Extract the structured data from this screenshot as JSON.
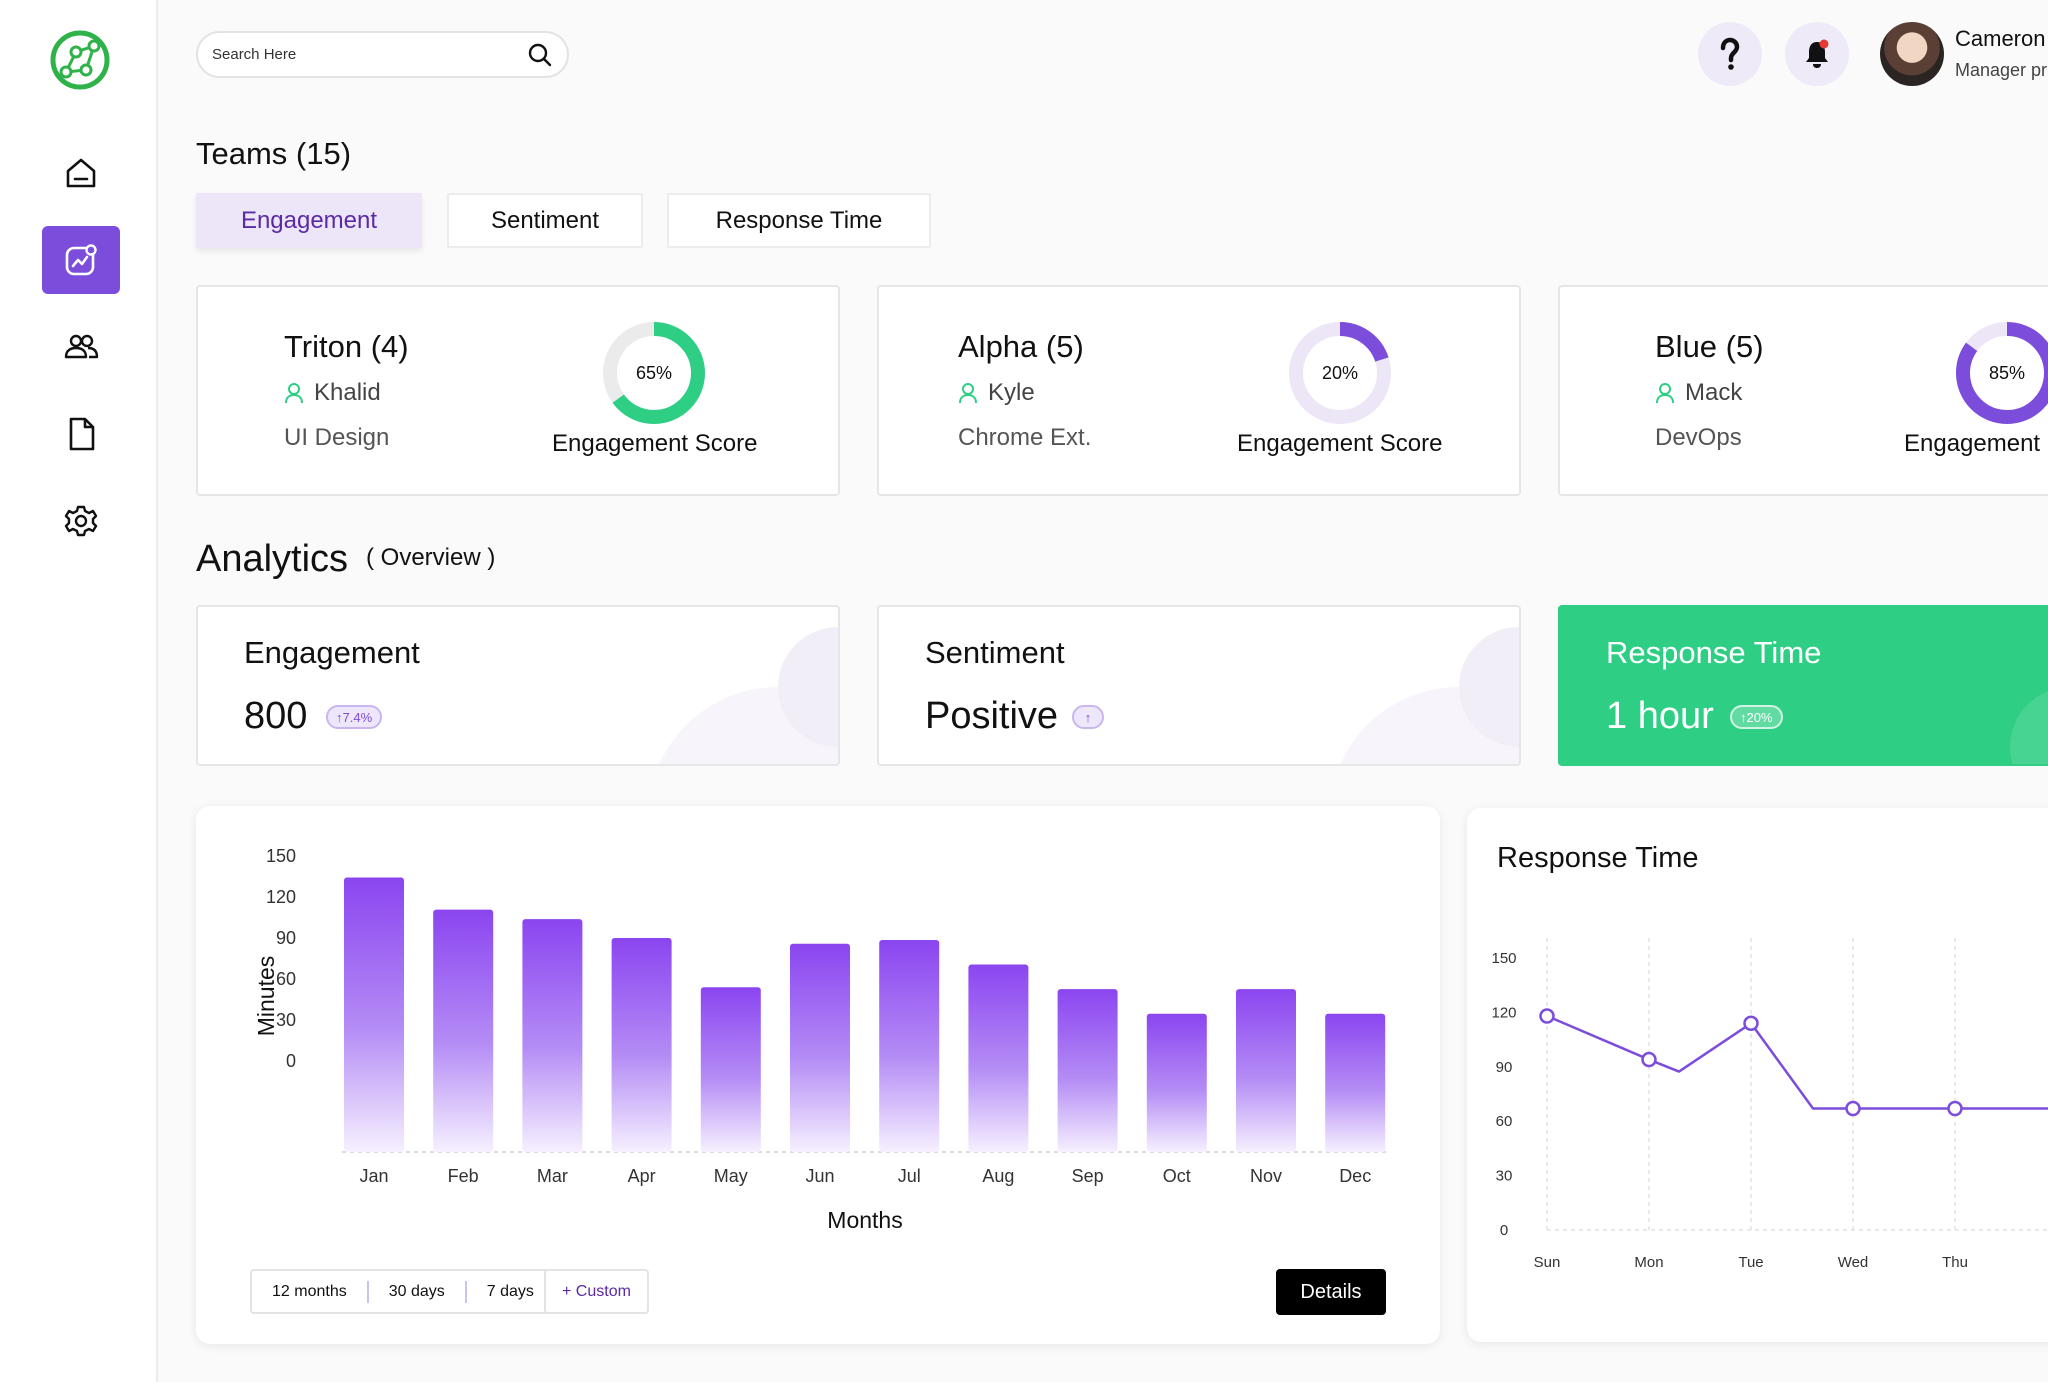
{
  "search": {
    "placeholder": "Search Here"
  },
  "user": {
    "name": "Cameron",
    "role": "Manager pr"
  },
  "teams": {
    "title": "Teams (15)",
    "tabs": [
      "Engagement",
      "Sentiment",
      "Response Time"
    ],
    "cards": [
      {
        "name": "Triton (4)",
        "lead": "Khalid",
        "dept": "UI Design",
        "score": "65%",
        "score_value": 0.65,
        "score_label": "Engagement Score",
        "color": "#2ecf85"
      },
      {
        "name": "Alpha (5)",
        "lead": "Kyle",
        "dept": "Chrome Ext.",
        "score": "20%",
        "score_value": 0.2,
        "score_label": "Engagement Score",
        "color": "#7c4ddb"
      },
      {
        "name": "Blue (5)",
        "lead": "Mack",
        "dept": "DevOps",
        "score": "85%",
        "score_value": 0.85,
        "score_label": "Engagement S",
        "color": "#7c4ddb"
      }
    ]
  },
  "analytics": {
    "title": "Analytics",
    "subtitle": "( Overview )",
    "stats": [
      {
        "title": "Engagement",
        "value": "800",
        "badge": "↑7.4%"
      },
      {
        "title": "Sentiment",
        "value": "Positive",
        "badge": "↑"
      },
      {
        "title": "Response Time",
        "value": "1 hour",
        "badge": "↑20%"
      }
    ]
  },
  "bar_chart": {
    "range_buttons": [
      "12 months",
      "30 days",
      "7 days"
    ],
    "custom_label": "+ Custom",
    "details_label": "Details"
  },
  "response_chart": {
    "title": "Response Time"
  },
  "chart_data": [
    {
      "type": "bar",
      "categories": [
        "Jan",
        "Feb",
        "Mar",
        "Apr",
        "May",
        "Jun",
        "Jul",
        "Aug",
        "Sep",
        "Oct",
        "Nov",
        "Dec"
      ],
      "values": [
        145,
        128,
        123,
        113,
        87,
        110,
        112,
        99,
        86,
        73,
        86,
        73
      ],
      "xlabel": "Months",
      "ylabel": "Minutes",
      "yticks": [
        0,
        30,
        60,
        90,
        120,
        150
      ],
      "ylim": [
        0,
        150
      ],
      "color": "#8b45f0"
    },
    {
      "type": "line",
      "title": "Response Time",
      "x": [
        "Sun",
        "Mon",
        "Tue",
        "Wed",
        "Thu"
      ],
      "values": [
        118,
        94,
        114,
        67,
        67
      ],
      "yticks": [
        0,
        30,
        60,
        90,
        120,
        150
      ],
      "ylim": [
        0,
        150
      ],
      "color": "#7c4ddb"
    }
  ]
}
